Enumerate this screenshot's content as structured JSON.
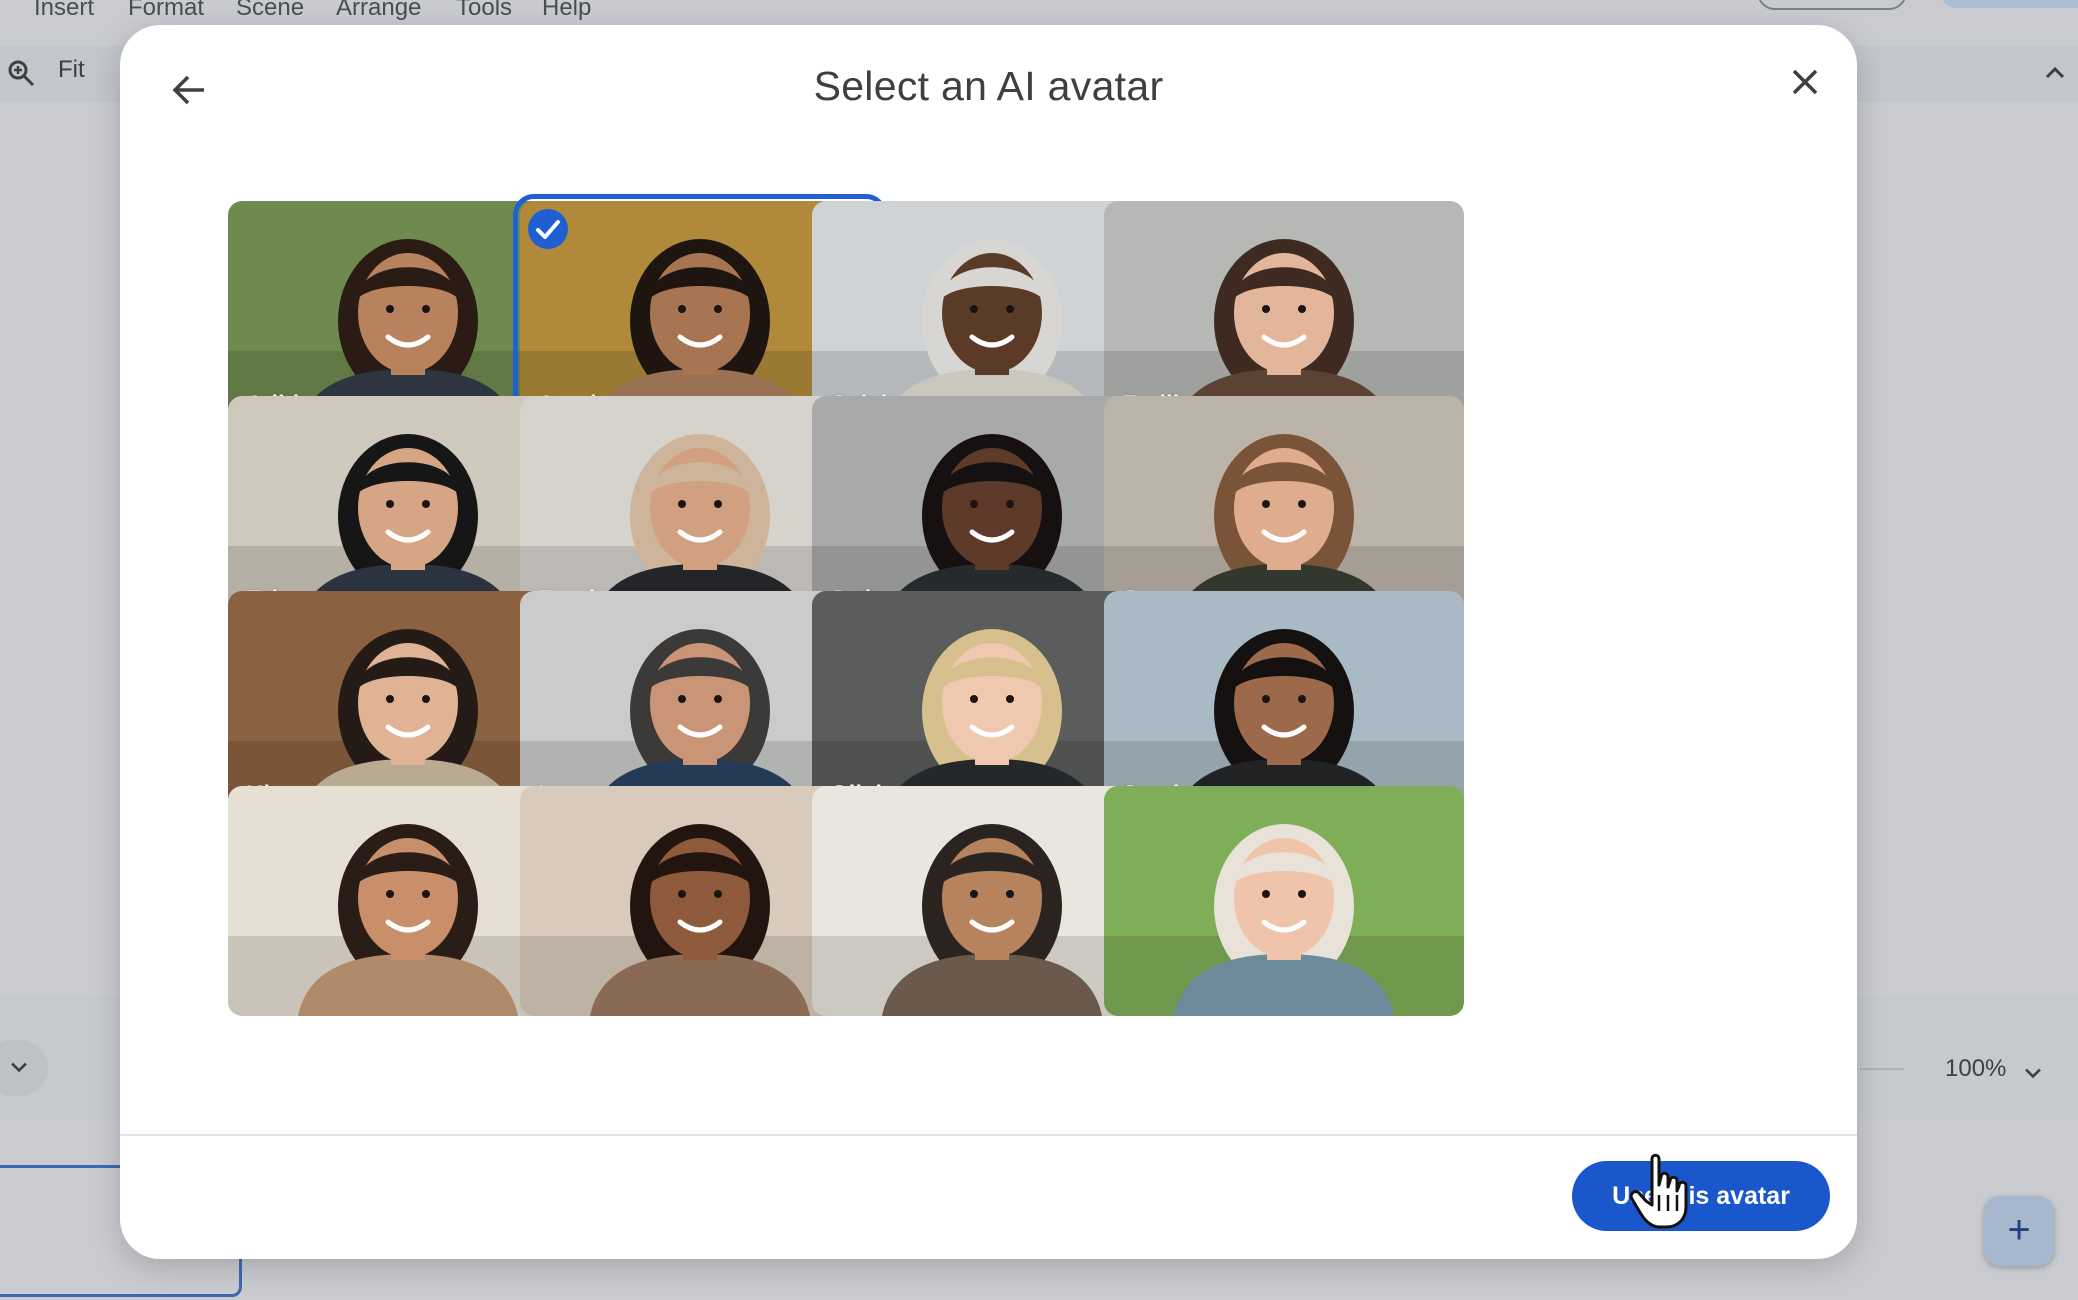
{
  "background_app": {
    "menu": [
      "Insert",
      "Format",
      "Scene",
      "Arrange",
      "Tools",
      "Help"
    ],
    "toolbar": {
      "zoom_fit_label": "Fit"
    },
    "footer": {
      "zoom_level": "100%"
    },
    "add_button_label": "+"
  },
  "dialog": {
    "title": "Select an AI avatar",
    "selected_avatar": "Amal",
    "avatars": [
      {
        "name": "Aditi",
        "bg": "#6f8a4f",
        "skin": "#b9825f",
        "hair": "#2a1b14",
        "shirt": "#2d3640"
      },
      {
        "name": "Amal",
        "bg": "#b08a3a",
        "skin": "#a87552",
        "hair": "#1e1511",
        "shirt": "#9a7152"
      },
      {
        "name": "Caleb",
        "bg": "#cfd3d5",
        "skin": "#5c3a28",
        "hair": "#d8d6d2",
        "shirt": "#c9c7be"
      },
      {
        "name": "Emilia",
        "bg": "#b6b8b5",
        "skin": "#e3b69c",
        "hair": "#3e2a20",
        "shirt": "#5c4234"
      },
      {
        "name": "Eric",
        "bg": "#cfc8bd",
        "skin": "#d5a585",
        "hair": "#161616",
        "shirt": "#2c3340"
      },
      {
        "name": "Farah",
        "bg": "#d6d2cc",
        "skin": "#d1a081",
        "hair": "#cdb49a",
        "shirt": "#232529"
      },
      {
        "name": "Jada",
        "bg": "#a8aaa9",
        "skin": "#5d3a29",
        "hair": "#161110",
        "shirt": "#272a2d"
      },
      {
        "name": "James",
        "bg": "#bdb4a9",
        "skin": "#e0ac8e",
        "hair": "#7a5438",
        "shirt": "#33382f"
      },
      {
        "name": "Kim",
        "bg": "#8b6140",
        "skin": "#e0b395",
        "hair": "#241a16",
        "shirt": "#b9ab93"
      },
      {
        "name": "Leo",
        "bg": "#c9ccc9",
        "skin": "#c99576",
        "hair": "#3b3a39",
        "shirt": "#253a57"
      },
      {
        "name": "Olivia",
        "bg": "#5a5d5b",
        "skin": "#f0c8b0",
        "hair": "#d8c08e",
        "shirt": "#25282b"
      },
      {
        "name": "Samir",
        "bg": "#a9bac4",
        "skin": "#9c6a4b",
        "hair": "#141110",
        "shirt": "#202224"
      },
      {
        "name": "",
        "bg": "#e6dfd4",
        "skin": "#c98e6a",
        "hair": "#2a1d18",
        "shirt": "#b08a6a"
      },
      {
        "name": "",
        "bg": "#d9cbbb",
        "skin": "#8f5a3c",
        "hair": "#22150f",
        "shirt": "#8a6a55"
      },
      {
        "name": "",
        "bg": "#e9e5df",
        "skin": "#b7835f",
        "hair": "#2b2320",
        "shirt": "#6b5a4c"
      },
      {
        "name": "",
        "bg": "#7fae58",
        "skin": "#efc4aa",
        "hair": "#e8e2d8",
        "shirt": "#6d8a9a"
      }
    ],
    "primary_button": "Use this avatar",
    "colors": {
      "accent": "#1a56cc",
      "selection": "#1f5fd1"
    }
  }
}
